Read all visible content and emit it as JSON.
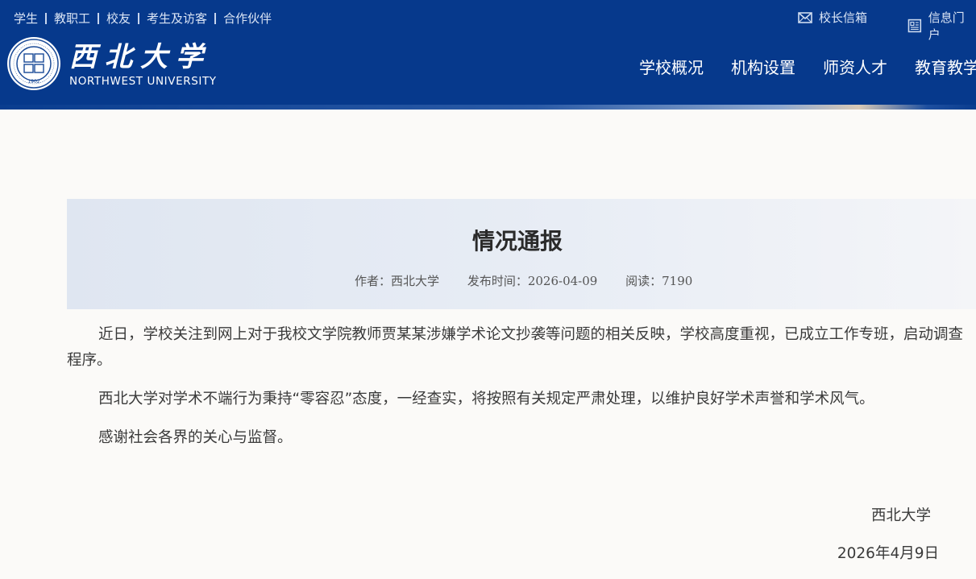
{
  "header": {
    "top_links": [
      "学生",
      "教职工",
      "校友",
      "考生及访客",
      "合作伙伴"
    ],
    "mailbox_label": "校长信箱",
    "portal_label": "信息门户",
    "logo": {
      "cn_name": "西北大学",
      "en_name": "NORTHWEST UNIVERSITY",
      "seal_text": "NORTHWEST UNIVERSITY XI'AN CHINA",
      "seal_year": "1902"
    },
    "nav": [
      "学校概况",
      "机构设置",
      "师资人才",
      "教育教学"
    ]
  },
  "article": {
    "title": "情况通报",
    "author_label": "作者：",
    "author": "西北大学",
    "date_label": "发布时间：",
    "date": "2026-04-09",
    "views_label": "阅读：",
    "views": "7190",
    "paragraphs": [
      "近日，学校关注到网上对于我校文学院教师贾某某涉嫌学术论文抄袭等问题的相关反映，学校高度重视，已成立工作专班，启动调查程序。",
      "西北大学对学术不端行为秉持“零容忍”态度，一经查实，将按照有关规定严肃处理，以维护良好学术声誉和学术风气。",
      "感谢社会各界的关心与监督。"
    ],
    "signature": "西北大学",
    "signature_date": "2026年4月9日"
  },
  "colors": {
    "header_bg": "#06398c",
    "title_band": "#dfe6f1",
    "body_text": "#3a3a3a"
  },
  "icons": {
    "mailbox": "envelope-icon",
    "portal": "newspaper-icon"
  }
}
